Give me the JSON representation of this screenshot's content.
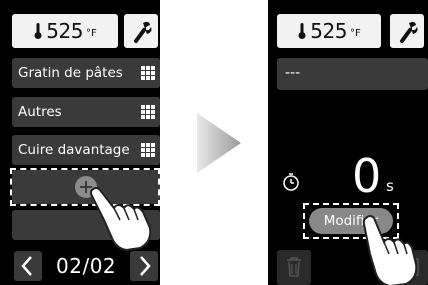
{
  "left_screen": {
    "temperature": {
      "value": "525",
      "unit": "°F"
    },
    "tool_icon": "wrench-icon",
    "programs": [
      {
        "label": "Gratin de pâtes",
        "icon": "grid-icon"
      },
      {
        "label": "Autres",
        "icon": "grid-icon"
      },
      {
        "label": "Cuire davantage",
        "icon": "grid-icon"
      }
    ],
    "add_slot_icon": "plus-circle-icon",
    "pagination": {
      "label": "02/02",
      "prev_icon": "chevron-left-icon",
      "next_icon": "chevron-right-icon"
    }
  },
  "transition_icon": "right-arrow-icon",
  "right_screen": {
    "temperature": {
      "value": "525",
      "unit": "°F"
    },
    "tool_icon": "wrench-icon",
    "name_field": "---",
    "timer": {
      "icon": "timer-icon",
      "value": "0",
      "unit": "s"
    },
    "modify_button": "Modifier",
    "delete_icon": "trash-icon",
    "save_icon": "save-icon"
  },
  "colors": {
    "screen_bg": "#000000",
    "tile_bg": "#3a3a3a",
    "pill_bg": "#888888"
  }
}
